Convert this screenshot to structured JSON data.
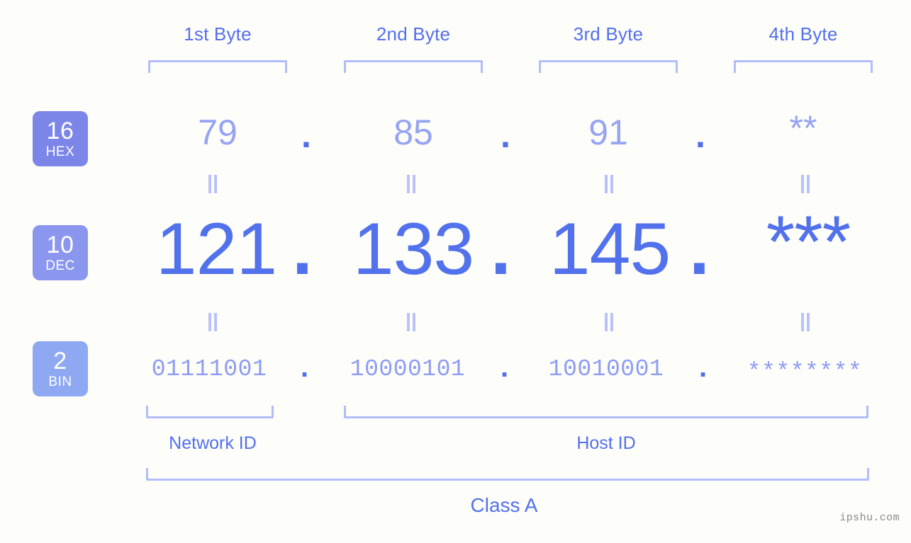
{
  "background_color": "#fdfdfa",
  "accent_colors": {
    "primary_blue": "#5271ed",
    "light_blue": "#97a4f2",
    "bracket_blue": "#b3bdfb",
    "badge_hex": "#7b86e8",
    "badge_dec": "#8b97ee",
    "badge_bin": "#8fa8f2",
    "watermark_gray": "#8a8a8a"
  },
  "byte_headers": [
    {
      "label": "1st Byte"
    },
    {
      "label": "2nd Byte"
    },
    {
      "label": "3rd Byte"
    },
    {
      "label": "4th Byte"
    }
  ],
  "bases": [
    {
      "number": "16",
      "abbr": "HEX"
    },
    {
      "number": "10",
      "abbr": "DEC"
    },
    {
      "number": "2",
      "abbr": "BIN"
    }
  ],
  "rows": {
    "hex": {
      "base_number": "16",
      "base_abbr": "HEX",
      "values": [
        "79",
        "85",
        "91",
        "**"
      ],
      "separator": "."
    },
    "dec": {
      "base_number": "10",
      "base_abbr": "DEC",
      "values": [
        "121",
        "133",
        "145",
        "***"
      ],
      "separator": "."
    },
    "bin": {
      "base_number": "2",
      "base_abbr": "BIN",
      "values": [
        "01111001",
        "10000101",
        "10010001",
        "********"
      ],
      "separator": "."
    }
  },
  "equals_symbol": "=",
  "segments": {
    "network_id": "Network ID",
    "host_id": "Host ID",
    "class": "Class A"
  },
  "watermark": "ipshu.com"
}
